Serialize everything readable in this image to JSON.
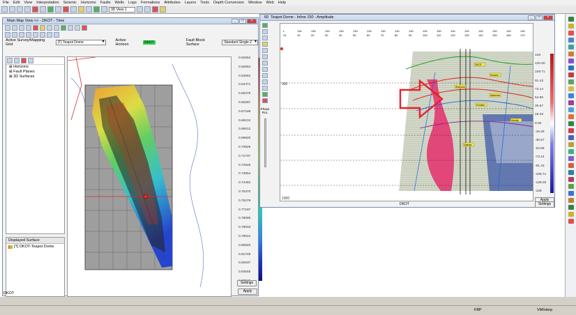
{
  "menu": [
    "File",
    "Edit",
    "View",
    "Interpretation",
    "Seismic",
    "Horizons",
    "Faults",
    "Wells",
    "Logs",
    "Formations",
    "Attributes",
    "Layers",
    "Tools",
    "Depth Conversion",
    "Window",
    "Web",
    "Help"
  ],
  "toolbar": {
    "view_combo": "3D View 1"
  },
  "map_window": {
    "title": "Main Map View <> - DKOT - Time",
    "survey_label": "Active Survey/Mapping Grid",
    "survey_value": "[T] Teapot Dome",
    "horizon_label": "Active Horizon",
    "horizon_value": "DKOT",
    "fault_label": "Fault Block Surface",
    "fault_value": "Standard Single Z",
    "tree": [
      "Horizons",
      "Fault Planes",
      "3D Surfaces"
    ],
    "displayed_surface_header": "Displayed Surface",
    "displayed_surface_item": "[T] DKOT-Teapot Dome",
    "colorbar_labels": [
      "0.62654",
      "0.62654",
      "0.63562",
      "0.64471",
      "0.65379",
      "0.66287",
      "0.67196",
      "0.68104",
      "0.69012",
      "0.69920",
      "0.70829",
      "0.71737",
      "0.72645",
      "0.73554",
      "0.74462",
      "0.75370",
      "0.76279",
      "0.77187",
      "0.78095",
      "0.79003",
      "0.79912",
      "0.80820",
      "0.81728",
      "0.82637",
      "0.83545",
      "0.83545"
    ],
    "apply_label": "Apply",
    "settings_label": "Settings",
    "footer_text": "DKOT"
  },
  "seis_window": {
    "title": "Teapot Dome - Inline 150 - Amplitude",
    "win_id": "60",
    "tick_labels_top": [
      "L",
      "130",
      "130",
      "130",
      "130",
      "130",
      "130",
      "130",
      "130",
      "130",
      "130",
      "130",
      "130",
      "130",
      "130",
      "130",
      "130",
      "130"
    ],
    "tick_labels_bot": [
      "XL",
      "10",
      "20",
      "30",
      "40",
      "50",
      "60",
      "70",
      "80",
      "90",
      "100",
      "110",
      "120",
      "130",
      "140",
      "150",
      "160",
      "170"
    ],
    "time_labels": [
      "900",
      "1000"
    ],
    "phase_label": "Phase Rot.",
    "colorbar_labels": [
      "128",
      "120.00",
      "109.71",
      "91.43",
      "73.14",
      "54.86",
      "36.57",
      "18.29",
      "0.00",
      "-18.29",
      "-36.57",
      "-54.86",
      "-73.14",
      "-91.43",
      "-109.71",
      "-128.00",
      "-128"
    ],
    "apply_label": "Apply",
    "settings_label": "Settings",
    "footer_text": "DKOT",
    "horizon_tags": [
      "DKOT",
      "Sussex",
      "Shannon",
      "Niobrara",
      "Frontier",
      "Muddy",
      "Dakota"
    ]
  },
  "status": {
    "left": "DKOT",
    "fbp": "FBP",
    "app": "VMInterp"
  },
  "colors": {
    "arrow": "#e8202c",
    "title_blue": "#c3d4ea",
    "status_green": "#2fd24a"
  }
}
